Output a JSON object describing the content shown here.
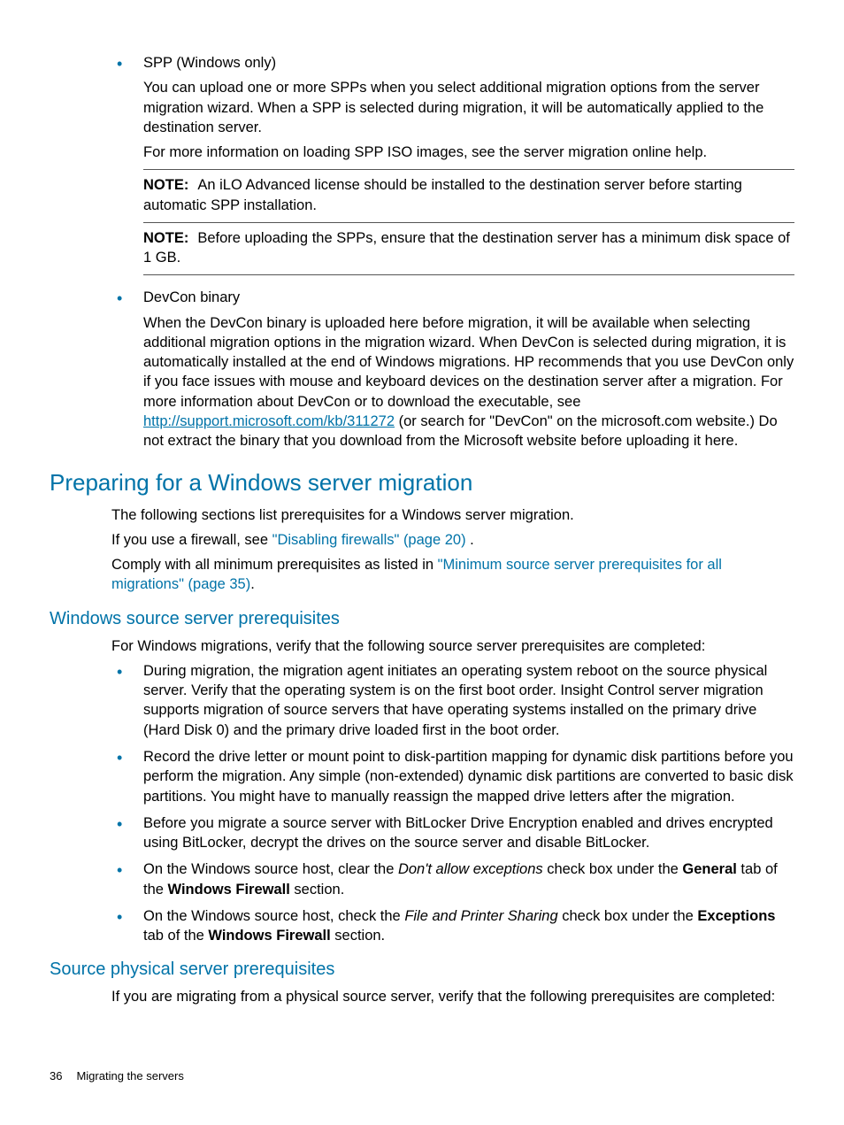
{
  "li1": {
    "head": "SPP (Windows only)",
    "p1": "You can upload one or more SPPs when you select additional migration options from the server migration wizard. When a SPP is selected during migration, it will be automatically applied to the destination server.",
    "p2": "For more information on loading SPP ISO images, see the server migration online help.",
    "note1_label": "NOTE:",
    "note1": "An iLO Advanced license should be installed to the destination server before starting automatic SPP installation.",
    "note2_label": "NOTE:",
    "note2": "Before uploading the SPPs, ensure that the destination server has a minimum disk space of 1 GB."
  },
  "li2": {
    "head": "DevCon binary",
    "p1a": "When the DevCon binary is uploaded here before migration, it will be available when selecting additional migration options in the migration wizard. When DevCon is selected during migration, it is automatically installed at the end of Windows migrations. HP recommends that you use DevCon only if you face issues with mouse and keyboard devices on the destination server after a migration. For more information about DevCon or to download the executable, see ",
    "link": "http://support.microsoft.com/kb/311272",
    "p1b": " (or search for \"DevCon\" on the microsoft.com website.) Do not extract the binary that you download from the Microsoft website before uploading it here."
  },
  "h2": "Preparing for a Windows server migration",
  "p_intro1": "The following sections list prerequisites for a Windows server migration.",
  "p_intro2a": "If you use a firewall, see ",
  "xref_fw": "\"Disabling firewalls\" (page 20)",
  "p_intro2b": " .",
  "p_intro3a": "Comply with all minimum prerequisites as listed in ",
  "xref_min": "\"Minimum source server prerequisites for all migrations\" (page 35)",
  "p_intro3b": ".",
  "h3a": "Windows source server prerequisites",
  "p_wsrc": "For Windows migrations, verify that the following source server prerequisites are completed:",
  "wlist": {
    "i1": "During migration, the migration agent initiates an operating system reboot on the source physical server. Verify that the operating system is on the first boot order. Insight Control server migration supports migration of source servers that have operating systems installed on the primary drive (Hard Disk 0) and the primary drive loaded first in the boot order.",
    "i2": "Record the drive letter or mount point to disk-partition mapping for dynamic disk partitions before you perform the migration. Any simple (non-extended) dynamic disk partitions are converted to basic disk partitions. You might have to manually reassign the mapped drive letters after the migration.",
    "i3": "Before you migrate a source server with BitLocker Drive Encryption enabled and drives encrypted using BitLocker, decrypt the drives on the source server and disable BitLocker.",
    "i4a": "On the Windows source host, clear the ",
    "i4_em": "Don't allow exceptions",
    "i4b": " check box under the ",
    "i4_b1": "General",
    "i4c": " tab of the ",
    "i4_b2": "Windows Firewall",
    "i4d": " section.",
    "i5a": "On the Windows source host, check the ",
    "i5_em": "File and Printer Sharing",
    "i5b": " check box under the ",
    "i5_b1": "Exceptions",
    "i5c": " tab of the ",
    "i5_b2": "Windows Firewall",
    "i5d": " section."
  },
  "h3b": "Source physical server prerequisites",
  "p_phys": "If you are migrating from a physical source server, verify that the following prerequisites are completed:",
  "footer": {
    "page": "36",
    "title": "Migrating the servers"
  }
}
